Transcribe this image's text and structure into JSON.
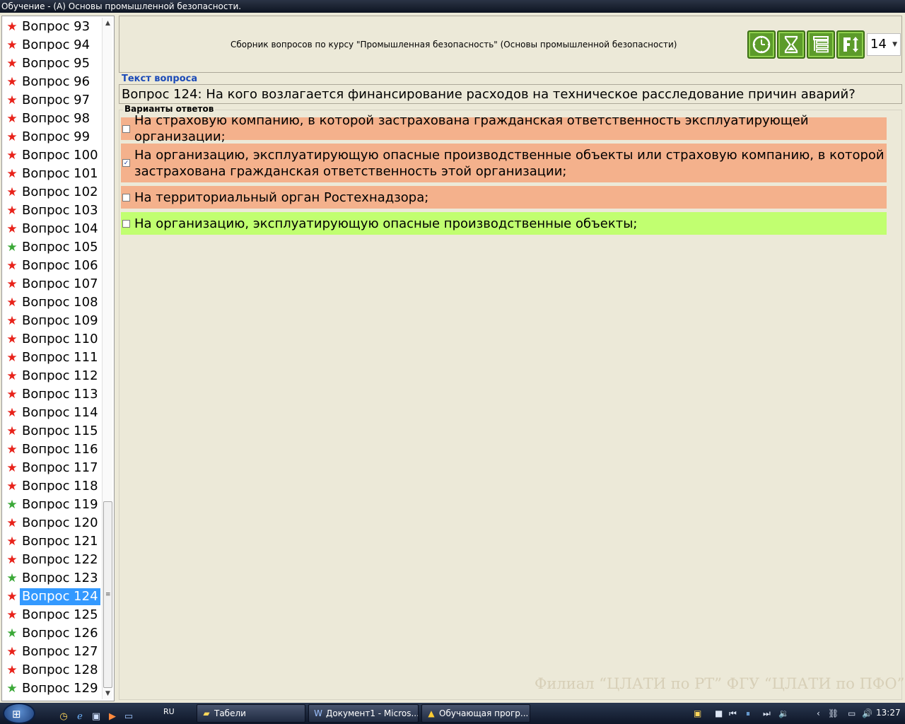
{
  "window": {
    "title": "Обучение - (А) Основы промышленной безопасности."
  },
  "sidebar": {
    "questions": [
      {
        "label": "Вопрос 93",
        "status": "red"
      },
      {
        "label": "Вопрос 94",
        "status": "red"
      },
      {
        "label": "Вопрос 95",
        "status": "red"
      },
      {
        "label": "Вопрос 96",
        "status": "red"
      },
      {
        "label": "Вопрос 97",
        "status": "red"
      },
      {
        "label": "Вопрос 98",
        "status": "red"
      },
      {
        "label": "Вопрос 99",
        "status": "red"
      },
      {
        "label": "Вопрос 100",
        "status": "red"
      },
      {
        "label": "Вопрос 101",
        "status": "red"
      },
      {
        "label": "Вопрос 102",
        "status": "red"
      },
      {
        "label": "Вопрос 103",
        "status": "red"
      },
      {
        "label": "Вопрос 104",
        "status": "red"
      },
      {
        "label": "Вопрос 105",
        "status": "green"
      },
      {
        "label": "Вопрос 106",
        "status": "red"
      },
      {
        "label": "Вопрос 107",
        "status": "red"
      },
      {
        "label": "Вопрос 108",
        "status": "red"
      },
      {
        "label": "Вопрос 109",
        "status": "red"
      },
      {
        "label": "Вопрос 110",
        "status": "red"
      },
      {
        "label": "Вопрос 111",
        "status": "red"
      },
      {
        "label": "Вопрос 112",
        "status": "red"
      },
      {
        "label": "Вопрос 113",
        "status": "red"
      },
      {
        "label": "Вопрос 114",
        "status": "red"
      },
      {
        "label": "Вопрос 115",
        "status": "red"
      },
      {
        "label": "Вопрос 116",
        "status": "red"
      },
      {
        "label": "Вопрос 117",
        "status": "red"
      },
      {
        "label": "Вопрос 118",
        "status": "red"
      },
      {
        "label": "Вопрос 119",
        "status": "green"
      },
      {
        "label": "Вопрос 120",
        "status": "red"
      },
      {
        "label": "Вопрос 121",
        "status": "red"
      },
      {
        "label": "Вопрос 122",
        "status": "red"
      },
      {
        "label": "Вопрос 123",
        "status": "green"
      },
      {
        "label": "Вопрос 124",
        "status": "red",
        "selected": true
      },
      {
        "label": "Вопрос 125",
        "status": "red"
      },
      {
        "label": "Вопрос 126",
        "status": "green"
      },
      {
        "label": "Вопрос 127",
        "status": "red"
      },
      {
        "label": "Вопрос 128",
        "status": "red"
      },
      {
        "label": "Вопрос 129",
        "status": "green"
      }
    ],
    "status_colors": {
      "red": "#e8221a",
      "green": "#3aa837"
    }
  },
  "header": {
    "course_title": "Сборник вопросов по курсу \"Промышленная безопасность\" (Основы промышленной безопасности)",
    "tools": [
      {
        "icon": "clock-icon"
      },
      {
        "icon": "hourglass-icon"
      },
      {
        "icon": "list-icon"
      },
      {
        "icon": "font-size-icon"
      }
    ],
    "font_size_value": "14"
  },
  "question": {
    "section_label": "Текст вопроса",
    "text": "Вопрос 124: На кого возлагается финансирование расходов на техническое расследование причин аварий?"
  },
  "answers": {
    "section_label": "Варианты ответов",
    "items": [
      {
        "text": "На страховую компанию, в которой застрахована гражданская ответственность эксплуатирующей организации;",
        "checked": false,
        "state": "wrong"
      },
      {
        "text": "На организацию, эксплуатирующую опасные производственные объекты или страховую компанию, в которой застрахована гражданская ответственность этой организации;",
        "checked": true,
        "state": "wrong"
      },
      {
        "text": "На территориальный орган Ростехнадзора;",
        "checked": false,
        "state": "wrong"
      },
      {
        "text": "На организацию, эксплуатирующую опасные производственные объекты;",
        "checked": false,
        "state": "right"
      }
    ],
    "colors": {
      "wrong": "#f4b18c",
      "right": "#c1ff70"
    }
  },
  "watermark": "Филиал “ЦЛАТИ по РТ” ФГУ “ЦЛАТИ по ПФО”",
  "taskbar": {
    "language": "RU",
    "tasks": [
      {
        "label": "Табели"
      },
      {
        "label": "Документ1 - Micros..."
      },
      {
        "label": "Обучающая прогр..."
      }
    ],
    "clock": "13:27"
  }
}
